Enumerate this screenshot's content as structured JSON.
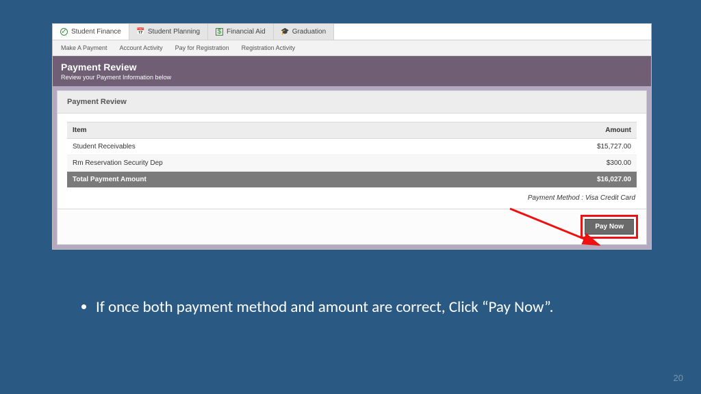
{
  "tabs": [
    {
      "label": "Student Finance",
      "active": true,
      "icon": "✓"
    },
    {
      "label": "Student Planning",
      "active": false,
      "icon": "📅"
    },
    {
      "label": "Financial Aid",
      "active": false,
      "icon": "$"
    },
    {
      "label": "Graduation",
      "active": false,
      "icon": "🎓"
    }
  ],
  "subnav": [
    "Make A Payment",
    "Account Activity",
    "Pay for Registration",
    "Registration Activity"
  ],
  "header": {
    "title": "Payment Review",
    "subtitle": "Review your Payment Information below"
  },
  "panel": {
    "title": "Payment Review",
    "table": {
      "cols": {
        "item": "Item",
        "amount": "Amount"
      },
      "rows": [
        {
          "item": "Student Receivables",
          "amount": "$15,727.00"
        },
        {
          "item": "Rm Reservation Security Dep",
          "amount": "$300.00"
        }
      ],
      "total": {
        "label": "Total Payment Amount",
        "amount": "$16,027.00"
      }
    },
    "method": "Payment Method : Visa Credit Card",
    "pay_label": "Pay Now"
  },
  "note": "If once both payment method and amount are correct, Click “Pay Now”.",
  "page_number": "20"
}
